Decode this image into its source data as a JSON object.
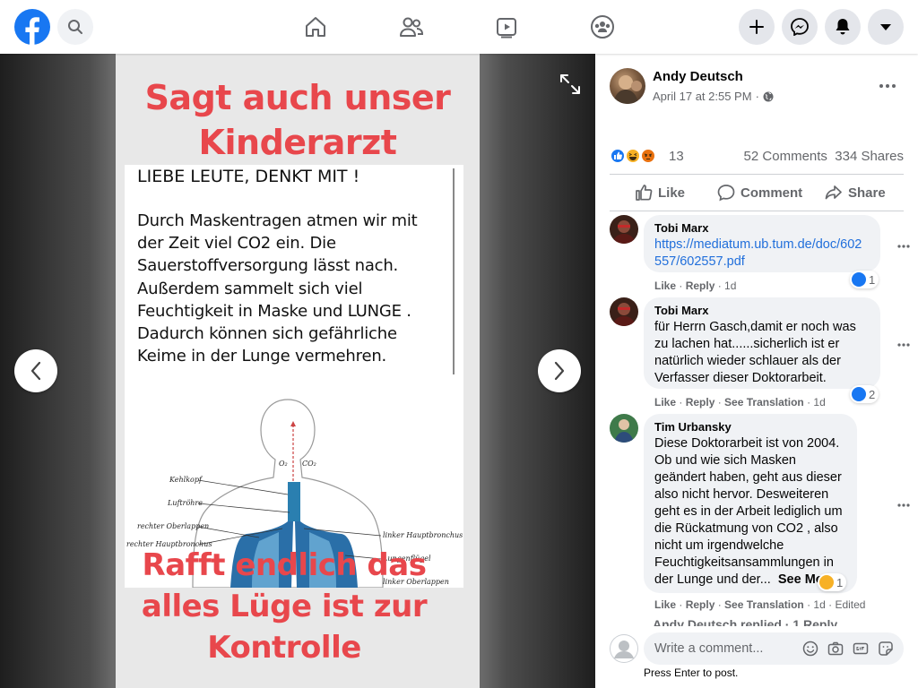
{
  "topbar": {
    "logo_icon": "facebook-logo-icon",
    "search_icon": "search-icon",
    "nav": [
      "home-icon",
      "friends-icon",
      "watch-icon",
      "groups-icon"
    ],
    "actions": [
      "plus-icon",
      "messenger-icon",
      "notifications-icon",
      "account-menu-icon"
    ]
  },
  "photo": {
    "title_line1": "Sagt auch unser",
    "title_line2": "Kinderarzt",
    "notice_heading": "LIEBE LEUTE, DENKT MIT !",
    "notice_lines": [
      "Durch Maskentragen atmen wir mit",
      "der Zeit viel CO2 ein. Die",
      "Sauerstoffversorgung lässt nach.",
      "Außerdem sammelt sich viel",
      "Feuchtigkeit in Maske und LUNGE .",
      "Dadurch können sich gefährliche",
      "Keime in der Lunge vermehren."
    ],
    "diagram_labels": {
      "o2": "O₂",
      "co2": "CO₂",
      "kehlkopf": "Kehlkopf",
      "luftroehre": "Luftröhre",
      "rechter_oberlappen": "rechter Oberlappen",
      "rechter_hauptbronchus": "rechter Hauptbronchus",
      "linker_hauptbronchus": "linker Hauptbronchus",
      "lungenfluegel": "Lungenflügel",
      "linker_oberlappen": "linker Oberlappen"
    },
    "footer_line1": "Rafft endlich das",
    "footer_line2": "alles Lüge ist zur",
    "footer_line3": "Kontrolle"
  },
  "post": {
    "author": "Andy Deutsch",
    "date": "April 17 at 2:55 PM",
    "separator": "·",
    "privacy_icon": "globe-icon",
    "reaction_count": "13",
    "comments": "52 Comments",
    "shares": "334 Shares",
    "like_label": "Like",
    "comment_label": "Comment",
    "share_label": "Share"
  },
  "comments": [
    {
      "author": "Tobi Marx",
      "link_line1": "https://mediatum.ub.tum.de/doc/602",
      "link_line2": "557/602557.pdf",
      "reaction_count": "1",
      "like": "Like",
      "reply": "Reply",
      "time": "1d"
    },
    {
      "author": "Tobi Marx",
      "lines": [
        "für Herrn Gasch,damit er noch was",
        "zu lachen hat......sicherlich ist er",
        "natürlich wieder schlauer als der",
        "Verfasser dieser Doktorarbeit."
      ],
      "reaction_count": "2",
      "like": "Like",
      "reply": "Reply",
      "translate": "See Translation",
      "time": "1d"
    },
    {
      "author": "Tim Urbansky",
      "lines": [
        "Diese Doktorarbeit ist von 2004.",
        "Ob und wie sich Masken",
        "geändert haben, geht aus dieser",
        "also nicht hervor. Desweiteren",
        "geht es in der Arbeit lediglich um",
        "die Rückatmung von CO2 , also",
        "nicht um irgendwelche",
        "Feuchtigkeitsansammlungen in"
      ],
      "last_line": "der Lunge und der...",
      "see_more": "See More",
      "reaction_count": "1",
      "like": "Like",
      "reply": "Reply",
      "translate": "See Translation",
      "time": "1d",
      "edited": "Edited"
    }
  ],
  "replied": {
    "text": "Andy Deutsch replied · 1 Reply"
  },
  "composer": {
    "placeholder": "Write a comment...",
    "hint": "Press Enter to post.",
    "tools": [
      "emoji-icon",
      "camera-icon",
      "gif-icon",
      "sticker-icon"
    ]
  },
  "colors": {
    "brand_blue": "#1877f2",
    "headline_red": "#e8474c",
    "link_blue": "#216fdb"
  }
}
